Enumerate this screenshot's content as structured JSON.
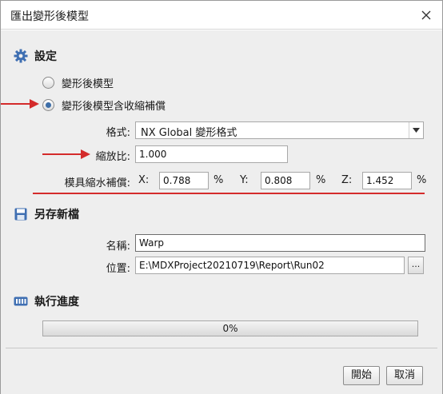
{
  "window": {
    "title": "匯出變形後模型"
  },
  "settings": {
    "header": "設定",
    "option_deformed": "變形後模型",
    "option_compensated": "變形後模型含收縮補償",
    "format_label": "格式:",
    "format_value": "NX Global 變形格式",
    "scale_label": "縮放比:",
    "scale_value": "1.000",
    "compensation_label": "模具縮水補償:",
    "x_label": "X:",
    "x_value": "0.788",
    "y_label": "Y:",
    "y_value": "0.808",
    "z_label": "Z:",
    "z_value": "1.452",
    "percent": "%"
  },
  "save_as": {
    "header": "另存新檔",
    "name_label": "名稱:",
    "name_value": "Warp",
    "location_label": "位置:",
    "location_value": "E:\\MDXProject20210719\\Report\\Run02",
    "browse_label": "..."
  },
  "progress": {
    "header": "執行進度",
    "text": "0%",
    "fraction": 0
  },
  "buttons": {
    "start": "開始",
    "cancel": "取消"
  },
  "colors": {
    "accent": "#3d6ea8",
    "annotation": "#d42b2b",
    "progress_fill": "#6aa5df"
  },
  "icons": {
    "settings": "gear-icon",
    "save": "floppy-disk-icon",
    "progress": "progress-bar-icon",
    "close": "close-icon",
    "dropdown": "triangle-down-icon"
  }
}
